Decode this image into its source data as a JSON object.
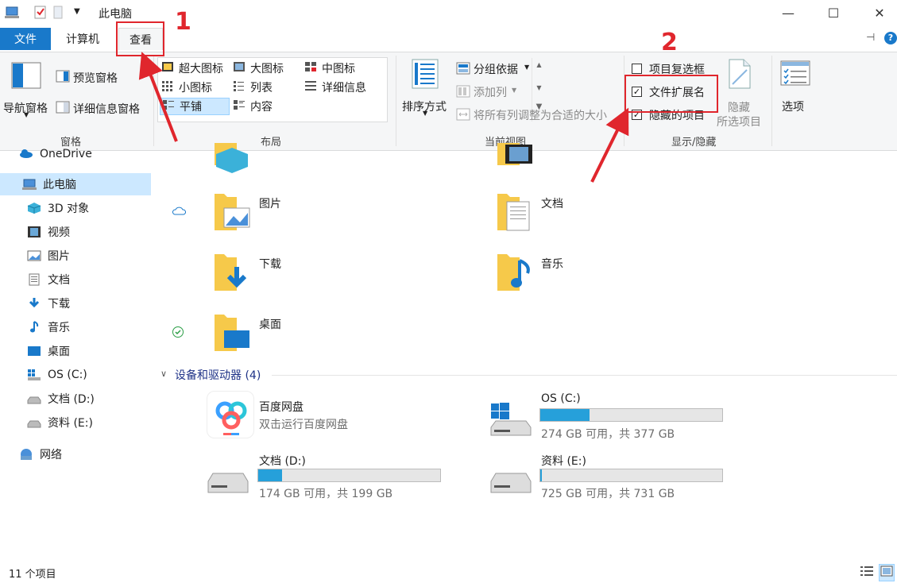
{
  "window": {
    "title": "此电脑",
    "minimize_glyph": "—",
    "maximize_glyph": "☐",
    "close_glyph": "✕"
  },
  "tabs": {
    "file": "文件",
    "computer": "计算机",
    "view": "查看"
  },
  "ribbon": {
    "panes": {
      "nav_pane": "导航窗格",
      "preview_pane": "预览窗格",
      "details_pane": "详细信息窗格",
      "group_label": "窗格"
    },
    "layout": {
      "items": [
        "超大图标",
        "大图标",
        "中图标",
        "小图标",
        "列表",
        "详细信息",
        "平铺",
        "内容"
      ],
      "selected": "平铺",
      "group_label": "布局"
    },
    "current_view": {
      "sort_by": "排序方式",
      "group_by": "分组依据",
      "add_columns": "添加列",
      "size_all_columns": "将所有列调整为合适的大小",
      "group_label": "当前视图"
    },
    "show_hide": {
      "item_checkboxes": "项目复选框",
      "item_checkboxes_checked": false,
      "file_extensions": "文件扩展名",
      "file_extensions_checked": true,
      "hidden_items": "隐藏的项目",
      "hidden_items_checked": true,
      "hide_selected_1": "隐藏",
      "hide_selected_2": "所选项目",
      "group_label": "显示/隐藏"
    },
    "options": "选项"
  },
  "nav": {
    "items": [
      {
        "label": "OneDrive",
        "icon": "cloud-icon"
      },
      {
        "label": "此电脑",
        "icon": "computer-icon",
        "selected": true
      },
      {
        "label": "3D 对象",
        "icon": "3d-objects-icon"
      },
      {
        "label": "视频",
        "icon": "video-icon"
      },
      {
        "label": "图片",
        "icon": "picture-icon"
      },
      {
        "label": "文档",
        "icon": "document-icon"
      },
      {
        "label": "下载",
        "icon": "download-icon"
      },
      {
        "label": "音乐",
        "icon": "music-icon"
      },
      {
        "label": "桌面",
        "icon": "desktop-icon"
      },
      {
        "label": "OS (C:)",
        "icon": "windows-drive-icon"
      },
      {
        "label": "文档 (D:)",
        "icon": "drive-icon"
      },
      {
        "label": "资料 (E:)",
        "icon": "drive-icon"
      },
      {
        "label": "网络",
        "icon": "network-icon"
      }
    ]
  },
  "folders": {
    "pictures": "图片",
    "documents": "文档",
    "downloads": "下载",
    "music": "音乐",
    "desktop": "桌面"
  },
  "devices": {
    "section_title": "设备和驱动器 (4)",
    "baidu": {
      "name": "百度网盘",
      "sub": "双击运行百度网盘"
    },
    "c": {
      "name": "OS (C:)",
      "sub": "274 GB 可用，共 377 GB",
      "used_fraction": 0.27
    },
    "d": {
      "name": "文档 (D:)",
      "sub": "174 GB 可用，共 199 GB",
      "used_fraction": 0.13
    },
    "e": {
      "name": "资料 (E:)",
      "sub": "725 GB 可用，共 731 GB",
      "used_fraction": 0.01
    }
  },
  "status": {
    "item_count": "11 个项目"
  },
  "annotations": {
    "step1": "1",
    "step2": "2"
  },
  "colors": {
    "accent": "#1979ca",
    "annotation": "#e0262d",
    "drive_bar": "#26a0da",
    "folder": "#f6c94a"
  }
}
